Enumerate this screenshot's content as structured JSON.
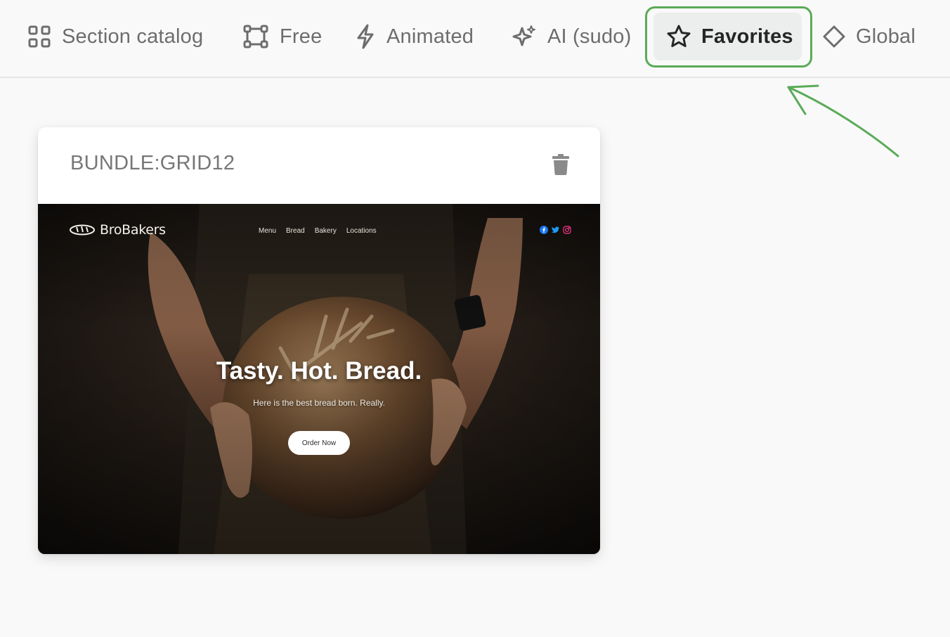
{
  "tabs": {
    "section_catalog": "Section catalog",
    "free": "Free",
    "animated": "Animated",
    "ai": "AI (sudo)",
    "favorites": "Favorites",
    "global": "Global"
  },
  "active_tab": "Favorites",
  "annotation": {
    "highlight_color": "#5aab58"
  },
  "card": {
    "title": "BUNDLE:GRID12",
    "delete_icon": "trash-icon",
    "preview": {
      "logo_text": "BroBakers",
      "nav": [
        "Menu",
        "Bread",
        "Bakery",
        "Locations"
      ],
      "social": [
        "facebook-icon",
        "twitter-icon",
        "instagram-icon"
      ],
      "headline": "Tasty. Hot. Bread.",
      "subtitle": "Here is the best bread born. Really.",
      "cta": "Order Now"
    }
  }
}
